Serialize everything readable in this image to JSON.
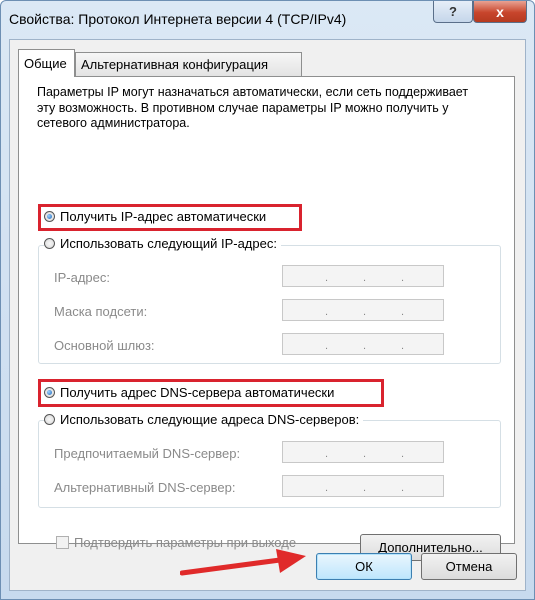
{
  "window": {
    "title": "Свойства: Протокол Интернета версии 4 (TCP/IPv4)",
    "help_symbol": "?",
    "close_symbol": "x"
  },
  "tabs": [
    {
      "label": "Общие",
      "active": true
    },
    {
      "label": "Альтернативная конфигурация",
      "active": false
    }
  ],
  "intro_text": "Параметры IP могут назначаться автоматически, если сеть поддерживает эту возможность. В противном случае параметры IP можно получить у сетевого администратора.",
  "ip_section": {
    "auto_label": "Получить IP-адрес автоматически",
    "auto_selected": true,
    "manual_label": "Использовать следующий IP-адрес:",
    "manual_selected": false,
    "fields": [
      {
        "label": "IP-адрес:",
        "value": ""
      },
      {
        "label": "Маска подсети:",
        "value": ""
      },
      {
        "label": "Основной шлюз:",
        "value": ""
      }
    ]
  },
  "dns_section": {
    "auto_label": "Получить адрес DNS-сервера автоматически",
    "auto_selected": true,
    "manual_label": "Использовать следующие адреса DNS-серверов:",
    "manual_selected": false,
    "fields": [
      {
        "label": "Предпочитаемый DNS-сервер:",
        "value": ""
      },
      {
        "label": "Альтернативный DNS-сервер:",
        "value": ""
      }
    ]
  },
  "validate_checkbox": {
    "label": "Подтвердить параметры при выходе",
    "checked": false
  },
  "buttons": {
    "advanced": "Дополнительно...",
    "ok": "ОК",
    "cancel": "Отмена"
  },
  "colors": {
    "highlight": "#d9232e",
    "arrow": "#e02a2a"
  }
}
